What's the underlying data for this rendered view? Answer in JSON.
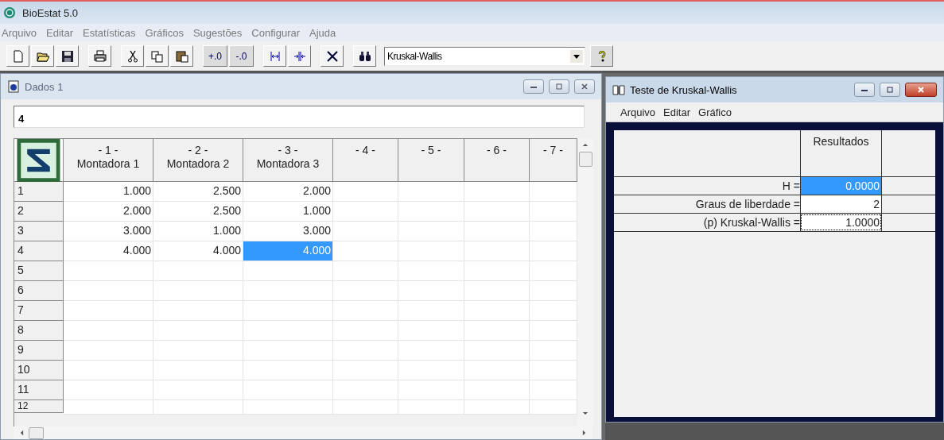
{
  "app": {
    "title": "BioEstat 5.0"
  },
  "menu": [
    {
      "label": "Arquivo"
    },
    {
      "label": "Editar"
    },
    {
      "label": "Estatísticas"
    },
    {
      "label": "Gráficos"
    },
    {
      "label": "Sugestões"
    },
    {
      "label": "Configurar"
    },
    {
      "label": "Ajuda"
    }
  ],
  "toolbar": {
    "buttons": [
      {
        "label": "+.0"
      },
      {
        "label": "-.0"
      }
    ],
    "analysis_select": {
      "value": "Kruskal-Wallis"
    }
  },
  "data_window": {
    "title": "Dados 1",
    "entry": {
      "value": "4"
    },
    "columns": [
      {
        "number": "- 1 -",
        "name": "Montadora 1"
      },
      {
        "number": "- 2 -",
        "name": "Montadora 2"
      },
      {
        "number": "- 3 -",
        "name": "Montadora 3"
      },
      {
        "number": "- 4 -"
      },
      {
        "number": "- 5 -"
      },
      {
        "number": "- 6 -"
      },
      {
        "number": "- 7 -"
      }
    ],
    "rows": [
      {
        "label": "1",
        "cells": [
          {
            "text": "1.000",
            "selected": false
          },
          {
            "text": "2.500",
            "selected": false
          },
          {
            "text": "2.000",
            "selected": false
          }
        ]
      },
      {
        "label": "2",
        "cells": [
          {
            "text": "2.000",
            "selected": false
          },
          {
            "text": "2.500",
            "selected": false
          },
          {
            "text": "1.000",
            "selected": false
          }
        ]
      },
      {
        "label": "3",
        "cells": [
          {
            "text": "3.000",
            "selected": false
          },
          {
            "text": "1.000",
            "selected": false
          },
          {
            "text": "3.000",
            "selected": false
          }
        ]
      },
      {
        "label": "4",
        "cells": [
          {
            "text": "4.000",
            "selected": false
          },
          {
            "text": "4.000",
            "selected": false
          },
          {
            "text": "4.000",
            "selected": true
          }
        ]
      },
      {
        "label": "5"
      },
      {
        "label": "6"
      },
      {
        "label": "7"
      },
      {
        "label": "8"
      },
      {
        "label": "9"
      },
      {
        "label": "10"
      },
      {
        "label": "11"
      },
      {
        "label": "12"
      }
    ]
  },
  "results_window": {
    "title": "Teste de Kruskal-Wallis",
    "menu": [
      {
        "label": "Arquivo"
      },
      {
        "label": "Editar"
      },
      {
        "label": "Gráfico"
      }
    ],
    "column": "Resultados",
    "rows": [
      {
        "label": "H =",
        "value": "0.0000",
        "selected": true,
        "focused": false
      },
      {
        "label": "Graus de liberdade =",
        "value": "2",
        "selected": false,
        "focused": false
      },
      {
        "label": "(p) Kruskal-Wallis =",
        "value": "1.0000",
        "selected": false,
        "focused": true
      }
    ]
  }
}
